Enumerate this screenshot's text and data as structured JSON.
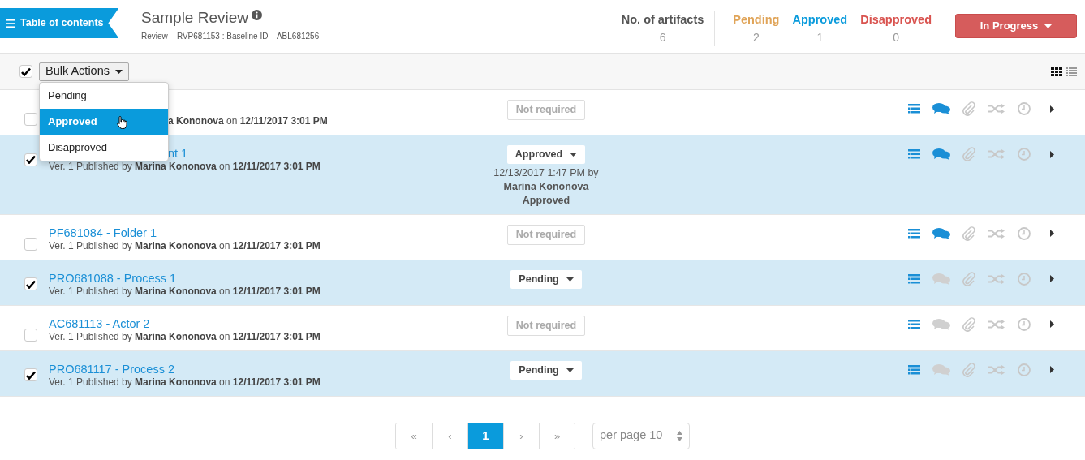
{
  "toc_button": {
    "label": "Table of contents"
  },
  "review": {
    "title": "Sample Review",
    "subtitle": "Review – RVP681153 : Baseline ID – ABL681256"
  },
  "artifact_count": {
    "label": "No. of artifacts",
    "value": "6"
  },
  "status_counts": [
    {
      "label": "Pending",
      "value": "2",
      "color": "#e0a458"
    },
    {
      "label": "Approved",
      "value": "1",
      "color": "#0a9bdc"
    },
    {
      "label": "Disapproved",
      "value": "0",
      "color": "#d9534f"
    }
  ],
  "status_button": {
    "label": "In Progress"
  },
  "toolbar": {
    "select_all_checked": true,
    "bulk_button": "Bulk Actions",
    "views": [
      {
        "kind": "grid",
        "selected": true
      },
      {
        "kind": "list",
        "selected": false
      }
    ]
  },
  "bulk_menu": [
    {
      "label": "Pending",
      "selected": false
    },
    {
      "label": "Approved",
      "selected": true
    },
    {
      "label": "Disapproved",
      "selected": false
    }
  ],
  "rows": [
    {
      "checked": false,
      "meta_covered": true,
      "meta": "**a Kononova** on **12/11/2017 3:01 PM**",
      "status": {
        "kind": "static",
        "label": "Not required"
      },
      "comments_active": true
    },
    {
      "checked": true,
      "title_covered": true,
      "title": "nt 1",
      "meta": "Ver. 1 Published by **Marina Kononova** on **12/11/2017 3:01 PM**",
      "status": {
        "kind": "dropdown",
        "label": "Approved",
        "by_line": "12/13/2017 1:47 PM by",
        "reviewer": "Marina Kononova",
        "decision": "Approved"
      },
      "comments_active": true
    },
    {
      "checked": false,
      "title": "PF681084 - Folder 1",
      "meta": "Ver. 1 Published by **Marina Kononova** on **12/11/2017 3:01 PM**",
      "status": {
        "kind": "static",
        "label": "Not required"
      },
      "comments_active": true
    },
    {
      "checked": true,
      "title": "PRO681088 - Process 1",
      "meta": "Ver. 1 Published by **Marina Kononova** on **12/11/2017 3:01 PM**",
      "status": {
        "kind": "dropdown",
        "label": "Pending"
      },
      "comments_active": false
    },
    {
      "checked": false,
      "title": "AC681113 - Actor 2",
      "meta": "Ver. 1 Published by **Marina Kononova** on **12/11/2017 3:01 PM**",
      "status": {
        "kind": "static",
        "label": "Not required"
      },
      "comments_active": false
    },
    {
      "checked": true,
      "title": "PRO681117 - Process 2",
      "meta": "Ver. 1 Published by **Marina Kononova** on **12/11/2017 3:01 PM**",
      "status": {
        "kind": "dropdown",
        "label": "Pending"
      },
      "comments_active": false
    }
  ],
  "pagination": {
    "first": "«",
    "prev": "‹",
    "pages": [
      {
        "label": "1",
        "selected": true
      }
    ],
    "next": "›",
    "last": "»"
  },
  "per_page": {
    "value": "per page 10"
  }
}
